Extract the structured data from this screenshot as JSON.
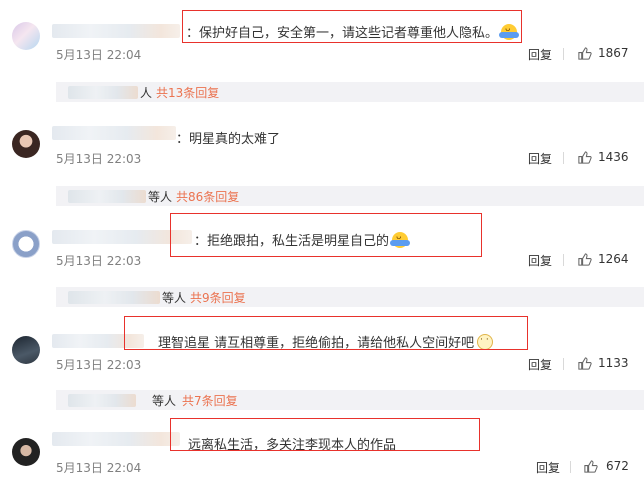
{
  "comments": [
    {
      "text": "：保护好自己，安全第一，请这些记者尊重他人隐私。",
      "emoji": "hug-emoji",
      "time": "5月13日 22:04",
      "reply_label": "回复",
      "likes": "1867",
      "sub": {
        "who": "人",
        "more": "共13条回复"
      }
    },
    {
      "text": "：明星真的太难了",
      "time": "5月13日 22:03",
      "reply_label": "回复",
      "likes": "1436",
      "sub": {
        "who": "等人",
        "more": "共86条回复"
      }
    },
    {
      "text": "：拒绝跟拍，私生活是明星自己的",
      "emoji": "hug-emoji",
      "time": "5月13日 22:03",
      "reply_label": "回复",
      "likes": "1264",
      "sub": {
        "who": "等人",
        "more": "共9条回复"
      }
    },
    {
      "text": "理智追星 请互相尊重，拒绝偷拍，请给他私人空间好吧",
      "emoji": "awkward-emoji",
      "time": "5月13日 22:03",
      "reply_label": "回复",
      "likes": "1133",
      "sub": {
        "who": "等人",
        "more": "共7条回复"
      }
    },
    {
      "text": "远离私生活，多关注李现本人的作品",
      "time": "5月13日 22:04",
      "reply_label": "回复",
      "likes": "672"
    }
  ],
  "colors": {
    "link": "#eb7350",
    "highlight_box": "#e8322c",
    "time": "#808080"
  },
  "icons": {
    "like": "thumbs-up-icon"
  }
}
